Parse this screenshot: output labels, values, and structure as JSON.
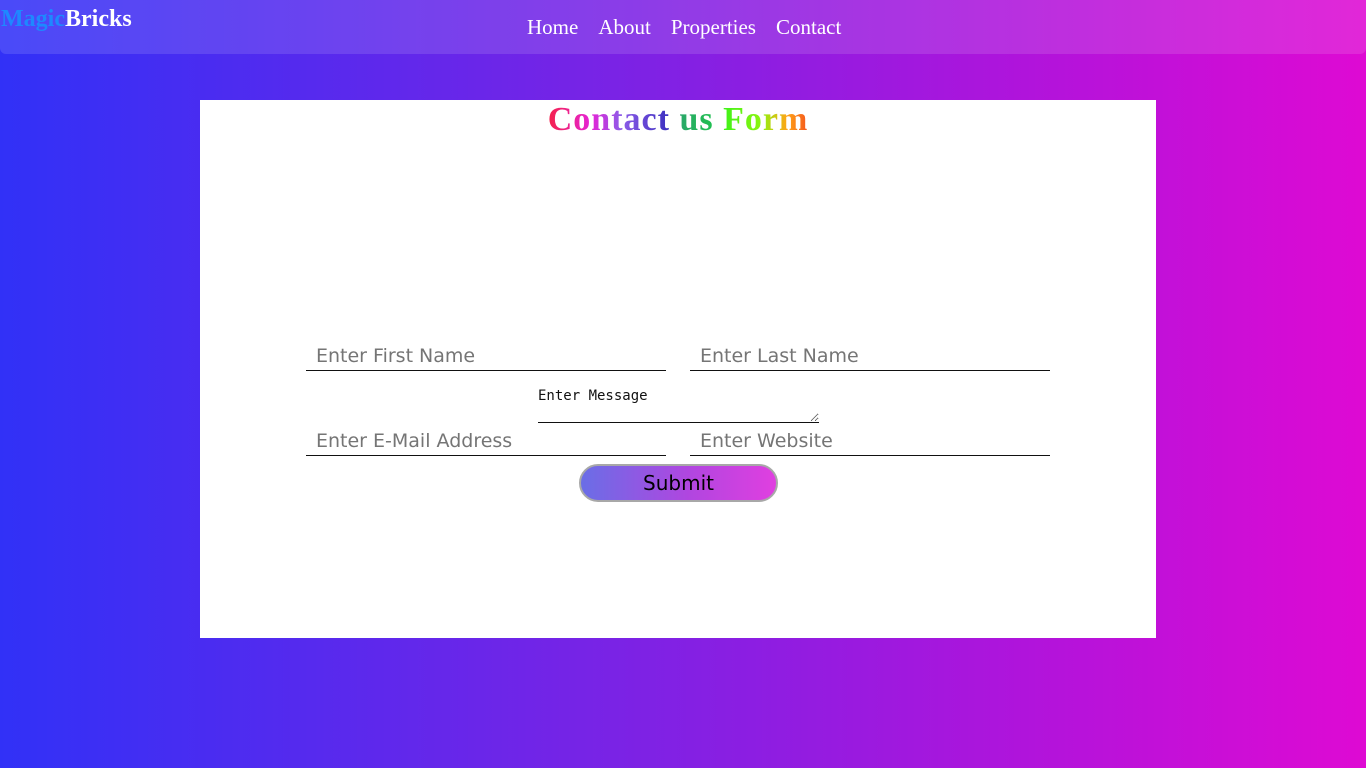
{
  "brand": {
    "part_a": "Magic",
    "part_b": "Bricks",
    "color_a": "#1e88ff",
    "color_b": "#ffffff"
  },
  "nav": {
    "items": [
      {
        "label": "Home"
      },
      {
        "label": "About"
      },
      {
        "label": "Properties"
      },
      {
        "label": "Contact"
      }
    ]
  },
  "form": {
    "title_words": [
      "Contact",
      "us",
      "Form"
    ],
    "first_name_placeholder": "Enter First Name",
    "last_name_placeholder": "Enter Last Name",
    "email_placeholder": "Enter E-Mail Address",
    "website_placeholder": "Enter Website",
    "message_placeholder": "Enter Message",
    "submit_label": "Submit"
  },
  "colors": {
    "background_start": "#3131f7",
    "background_end": "#de0ad3",
    "card": "#ffffff"
  }
}
